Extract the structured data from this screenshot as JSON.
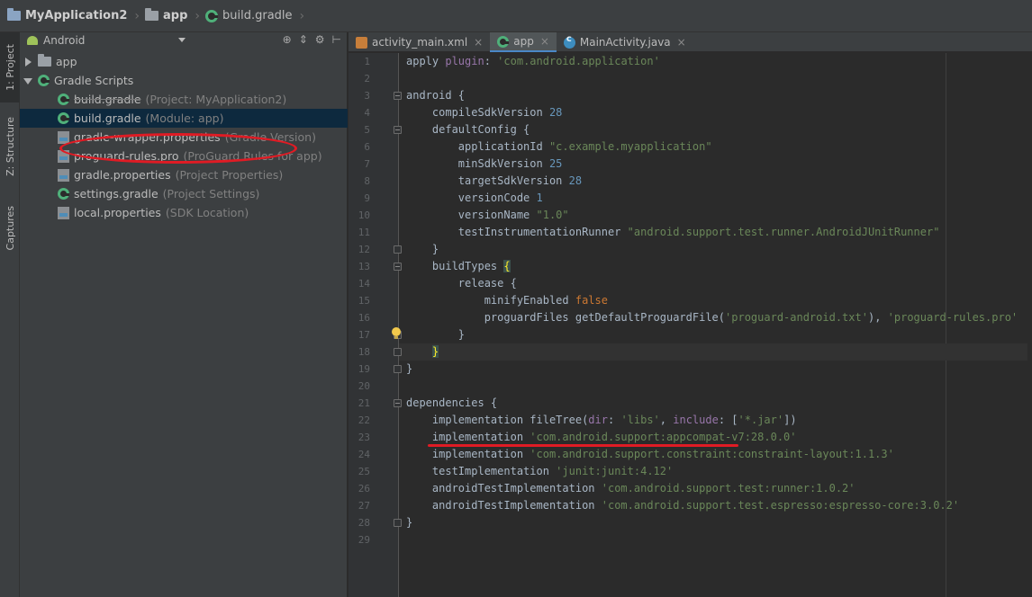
{
  "breadcrumb": [
    "MyApplication2",
    "app",
    "build.gradle"
  ],
  "left_strip": {
    "project_tab": "1: Project",
    "structure_tab": "Z: Structure",
    "captures_tab": "Captures"
  },
  "project_panel": {
    "view_mode": "Android"
  },
  "tree": [
    {
      "name": "app",
      "hint": "",
      "indent": 0,
      "arrow": "right",
      "icon": "folder",
      "selected": false
    },
    {
      "name": "Gradle Scripts",
      "hint": "",
      "indent": 0,
      "arrow": "down",
      "icon": "gradle",
      "selected": false
    },
    {
      "name": "build.gradle",
      "hint": "(Project: MyApplication2)",
      "indent": 1,
      "arrow": "",
      "icon": "gradle",
      "selected": false
    },
    {
      "name": "build.gradle",
      "hint": "(Module: app)",
      "indent": 1,
      "arrow": "",
      "icon": "gradle",
      "selected": true
    },
    {
      "name": "gradle-wrapper.properties",
      "hint": "(Gradle Version)",
      "indent": 1,
      "arrow": "",
      "icon": "props",
      "selected": false
    },
    {
      "name": "proguard-rules.pro",
      "hint": "(ProGuard Rules for app)",
      "indent": 1,
      "arrow": "",
      "icon": "props",
      "selected": false
    },
    {
      "name": "gradle.properties",
      "hint": "(Project Properties)",
      "indent": 1,
      "arrow": "",
      "icon": "props",
      "selected": false
    },
    {
      "name": "settings.gradle",
      "hint": "(Project Settings)",
      "indent": 1,
      "arrow": "",
      "icon": "gradle",
      "selected": false
    },
    {
      "name": "local.properties",
      "hint": "(SDK Location)",
      "indent": 1,
      "arrow": "",
      "icon": "props",
      "selected": false
    }
  ],
  "tabs": [
    {
      "label": "activity_main.xml",
      "icon": "xml",
      "active": false,
      "closable": true
    },
    {
      "label": "app",
      "icon": "gradle",
      "active": true,
      "closable": true
    },
    {
      "label": "MainActivity.java",
      "icon": "class",
      "active": false,
      "closable": true
    }
  ],
  "code_lines": [
    [
      [
        "apply ",
        ""
      ],
      [
        "plugin",
        "gd"
      ],
      [
        ": ",
        ""
      ],
      [
        "'com.android.application'",
        "gs"
      ]
    ],
    [],
    [
      [
        "android {",
        ""
      ]
    ],
    [
      [
        "    compileSdkVersion ",
        ""
      ],
      [
        "28",
        "gn"
      ]
    ],
    [
      [
        "    defaultConfig {",
        ""
      ]
    ],
    [
      [
        "        applicationId ",
        ""
      ],
      [
        "\"c.example.myapplication\"",
        "gs"
      ]
    ],
    [
      [
        "        minSdkVersion ",
        ""
      ],
      [
        "25",
        "gn"
      ]
    ],
    [
      [
        "        targetSdkVersion ",
        ""
      ],
      [
        "28",
        "gn"
      ]
    ],
    [
      [
        "        versionCode ",
        ""
      ],
      [
        "1",
        "gn"
      ]
    ],
    [
      [
        "        versionName ",
        ""
      ],
      [
        "\"1.0\"",
        "gs"
      ]
    ],
    [
      [
        "        testInstrumentationRunner ",
        ""
      ],
      [
        "\"android.support.test.runner.AndroidJUnitRunner\"",
        "gs"
      ]
    ],
    [
      [
        "    }",
        ""
      ]
    ],
    [
      [
        "    buildTypes ",
        ""
      ],
      [
        "{",
        "brace-hl"
      ]
    ],
    [
      [
        "        release {",
        ""
      ]
    ],
    [
      [
        "            minifyEnabled ",
        ""
      ],
      [
        "false",
        "gk"
      ]
    ],
    [
      [
        "            proguardFiles getDefaultProguardFile(",
        ""
      ],
      [
        "'proguard-android.txt'",
        "gs"
      ],
      [
        "), ",
        ""
      ],
      [
        "'proguard-rules.pro'",
        "gs"
      ]
    ],
    [
      [
        "        }",
        ""
      ]
    ],
    [
      [
        "    ",
        ""
      ],
      [
        "}",
        "brace-hl"
      ]
    ],
    [
      [
        "}",
        ""
      ]
    ],
    [],
    [
      [
        "dependencies {",
        ""
      ]
    ],
    [
      [
        "    implementation fileTree(",
        ""
      ],
      [
        "dir",
        "gd"
      ],
      [
        ": ",
        ""
      ],
      [
        "'libs'",
        "gs"
      ],
      [
        ", ",
        ""
      ],
      [
        "include",
        "gd"
      ],
      [
        ": [",
        ""
      ],
      [
        "'*.jar'",
        "gs"
      ],
      [
        "])",
        ""
      ]
    ],
    [
      [
        "    implementation ",
        ""
      ],
      [
        "'com.android.support:appcompat-v7:28.0.0'",
        "gs"
      ]
    ],
    [
      [
        "    implementation ",
        ""
      ],
      [
        "'com.android.support.constraint:constraint-layout:1.1.3'",
        "gs"
      ]
    ],
    [
      [
        "    testImplementation ",
        ""
      ],
      [
        "'junit:junit:4.12'",
        "gs"
      ]
    ],
    [
      [
        "    androidTestImplementation ",
        ""
      ],
      [
        "'com.android.support.test:runner:1.0.2'",
        "gs"
      ]
    ],
    [
      [
        "    androidTestImplementation ",
        ""
      ],
      [
        "'com.android.support.test.espresso:espresso-core:3.0.2'",
        "gs"
      ]
    ],
    [
      [
        "}",
        ""
      ]
    ],
    []
  ],
  "fold_markers": {
    "3": "start",
    "5": "start",
    "12": "end",
    "13": "start",
    "17": "end",
    "18": "end",
    "19": "end",
    "21": "start",
    "28": "end"
  },
  "bulb_line": 17,
  "caret_line": 18,
  "colors": {
    "annotation": "#e01b24",
    "string": "#6a8759",
    "number": "#6897bb",
    "keyword": "#cc7832"
  }
}
